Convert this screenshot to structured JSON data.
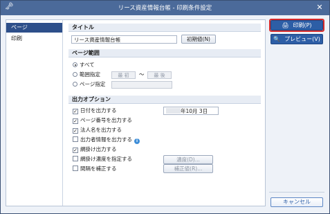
{
  "window": {
    "title": "リース資産情報台帳 - 印刷条件設定",
    "left_icon": "key-icon",
    "close_glyph": "✕"
  },
  "sidebar": {
    "items": [
      {
        "label": "ページ",
        "selected": true
      },
      {
        "label": "印刷",
        "selected": false
      }
    ]
  },
  "title_section": {
    "header": "タイトル",
    "value": "リース資産情報台帳",
    "reset_label": "初期値(N)"
  },
  "range_section": {
    "header": "ページ範囲",
    "all_label": "すべて",
    "range_label": "範囲指定",
    "range_from_placeholder": "最 初",
    "range_sep": "～",
    "range_to_placeholder": "最 後",
    "page_label": "ページ指定"
  },
  "options_section": {
    "header": "出力オプション",
    "date_label": "日付を出力する",
    "date_value": "年10月 3日",
    "pagenum_label": "ページ番号を出力する",
    "corp_label": "法人名を出力する",
    "outputter_label": "出力者情報を出力する",
    "shade_label": "網掛け出力する",
    "shade_density_label": "網掛け濃度を指定する",
    "density_button": "濃度(D)...",
    "spacing_label": "間隔を補正する",
    "adjust_button": "補正値(R)..."
  },
  "right_panel": {
    "print_label": "印刷(P)",
    "preview_label": "プレビュー(V)",
    "cancel_label": "キャンセル"
  },
  "colors": {
    "titlebar": "#4b6a9a",
    "accent": "#2d5ea6",
    "highlight_border": "#d62a2a"
  }
}
